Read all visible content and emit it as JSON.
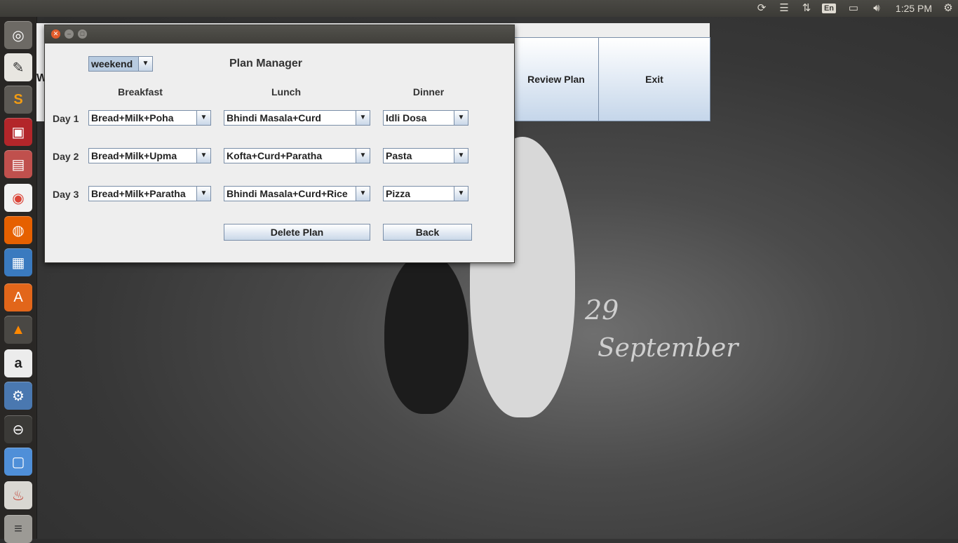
{
  "panel": {
    "language": "En",
    "clock": "1:25 PM"
  },
  "launcher": {
    "items": [
      "ubuntu-logo-icon",
      "text-editor-icon",
      "sublime-icon",
      "terminal-icon",
      "files-icon",
      "chrome-icon",
      "firefox-icon",
      "writer-icon",
      "software-center-icon",
      "vlc-icon",
      "amazon-icon",
      "settings-icon",
      "disk-icon",
      "virtualbox-icon",
      "java-icon",
      "trash-icon"
    ]
  },
  "background_window": {
    "partial_label": "W",
    "review_plan_label": "Review Plan",
    "exit_label": "Exit"
  },
  "wallpaper": {
    "day": "29",
    "month": "September"
  },
  "window": {
    "title": "Plan Manager",
    "mode_select": "weekend",
    "columns": [
      "Breakfast",
      "Lunch",
      "Dinner"
    ],
    "days": [
      {
        "label": "Day 1",
        "breakfast": "Bread+Milk+Poha",
        "lunch": "Bhindi Masala+Curd",
        "dinner": "Idli Dosa"
      },
      {
        "label": "Day 2",
        "breakfast": "Bread+Milk+Upma",
        "lunch": "Kofta+Curd+Paratha",
        "dinner": "Pasta"
      },
      {
        "label": "Day 3",
        "breakfast": "Bread+Milk+Paratha",
        "lunch": "Bhindi Masala+Curd+Rice",
        "dinner": "Pizza"
      }
    ],
    "delete_label": "Delete Plan",
    "back_label": "Back"
  }
}
